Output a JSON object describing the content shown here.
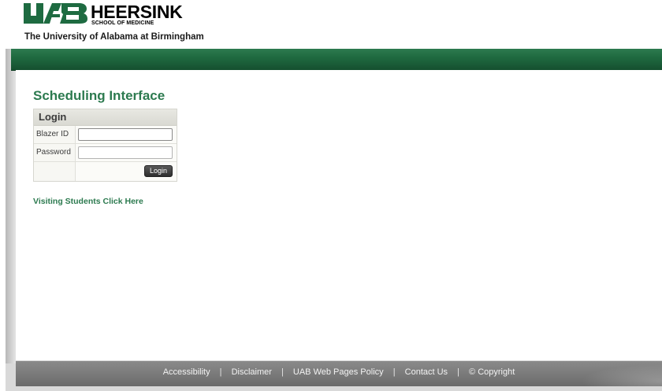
{
  "header": {
    "logo_mark": "UAB",
    "school_name": "HEERSINK",
    "school_sub": "SCHOOL OF MEDICINE",
    "university": "The University of Alabama at Birmingham"
  },
  "main": {
    "title": "Scheduling Interface",
    "login": {
      "heading": "Login",
      "blazer_label": "Blazer ID",
      "blazer_value": "",
      "password_label": "Password",
      "password_value": "",
      "button_label": "Login"
    },
    "visiting_link": "Visiting Students Click Here"
  },
  "footer": {
    "links": [
      "Accessibility",
      "Disclaimer",
      "UAB Web Pages Policy",
      "Contact Us",
      "© Copyright"
    ],
    "separator": "|"
  },
  "colors": {
    "brand_green": "#2c7a4f",
    "bar_green": "#1f6a40",
    "footer_gray": "#777777"
  }
}
